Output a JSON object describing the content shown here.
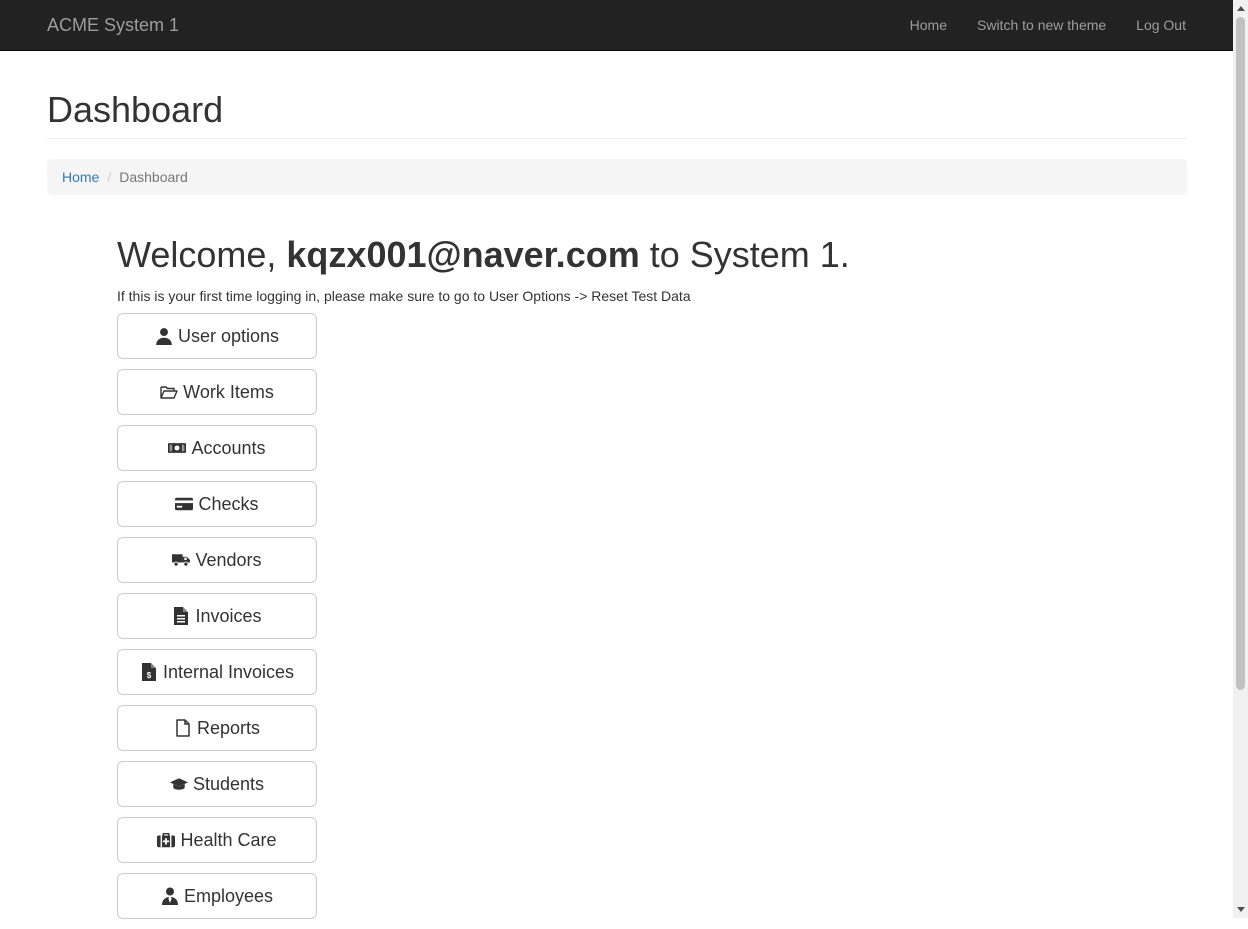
{
  "navbar": {
    "brand": "ACME System 1",
    "links": [
      {
        "label": "Home"
      },
      {
        "label": "Switch to new theme"
      },
      {
        "label": "Log Out"
      }
    ]
  },
  "page": {
    "title": "Dashboard",
    "breadcrumb": {
      "home": "Home",
      "separator": "/",
      "current": "Dashboard"
    }
  },
  "welcome": {
    "prefix": "Welcome,",
    "user": "kqzx001@naver.com",
    "suffix": "to System 1.",
    "notice": "If this is your first time logging in, please make sure to go to User Options -> Reset Test Data"
  },
  "menu": [
    {
      "label": "User options",
      "icon": "user-icon"
    },
    {
      "label": "Work Items",
      "icon": "folder-open-icon"
    },
    {
      "label": "Accounts",
      "icon": "money-bill-icon"
    },
    {
      "label": "Checks",
      "icon": "credit-card-icon"
    },
    {
      "label": "Vendors",
      "icon": "truck-icon"
    },
    {
      "label": "Invoices",
      "icon": "file-alt-icon"
    },
    {
      "label": "Internal Invoices",
      "icon": "file-invoice-dollar-icon"
    },
    {
      "label": "Reports",
      "icon": "file-icon"
    },
    {
      "label": "Students",
      "icon": "graduation-cap-icon"
    },
    {
      "label": "Health Care",
      "icon": "medkit-icon"
    },
    {
      "label": "Employees",
      "icon": "user-tie-icon"
    }
  ],
  "colors": {
    "navbar_bg": "#222222",
    "navbar_text": "#9d9d9d",
    "link": "#337ab7"
  }
}
